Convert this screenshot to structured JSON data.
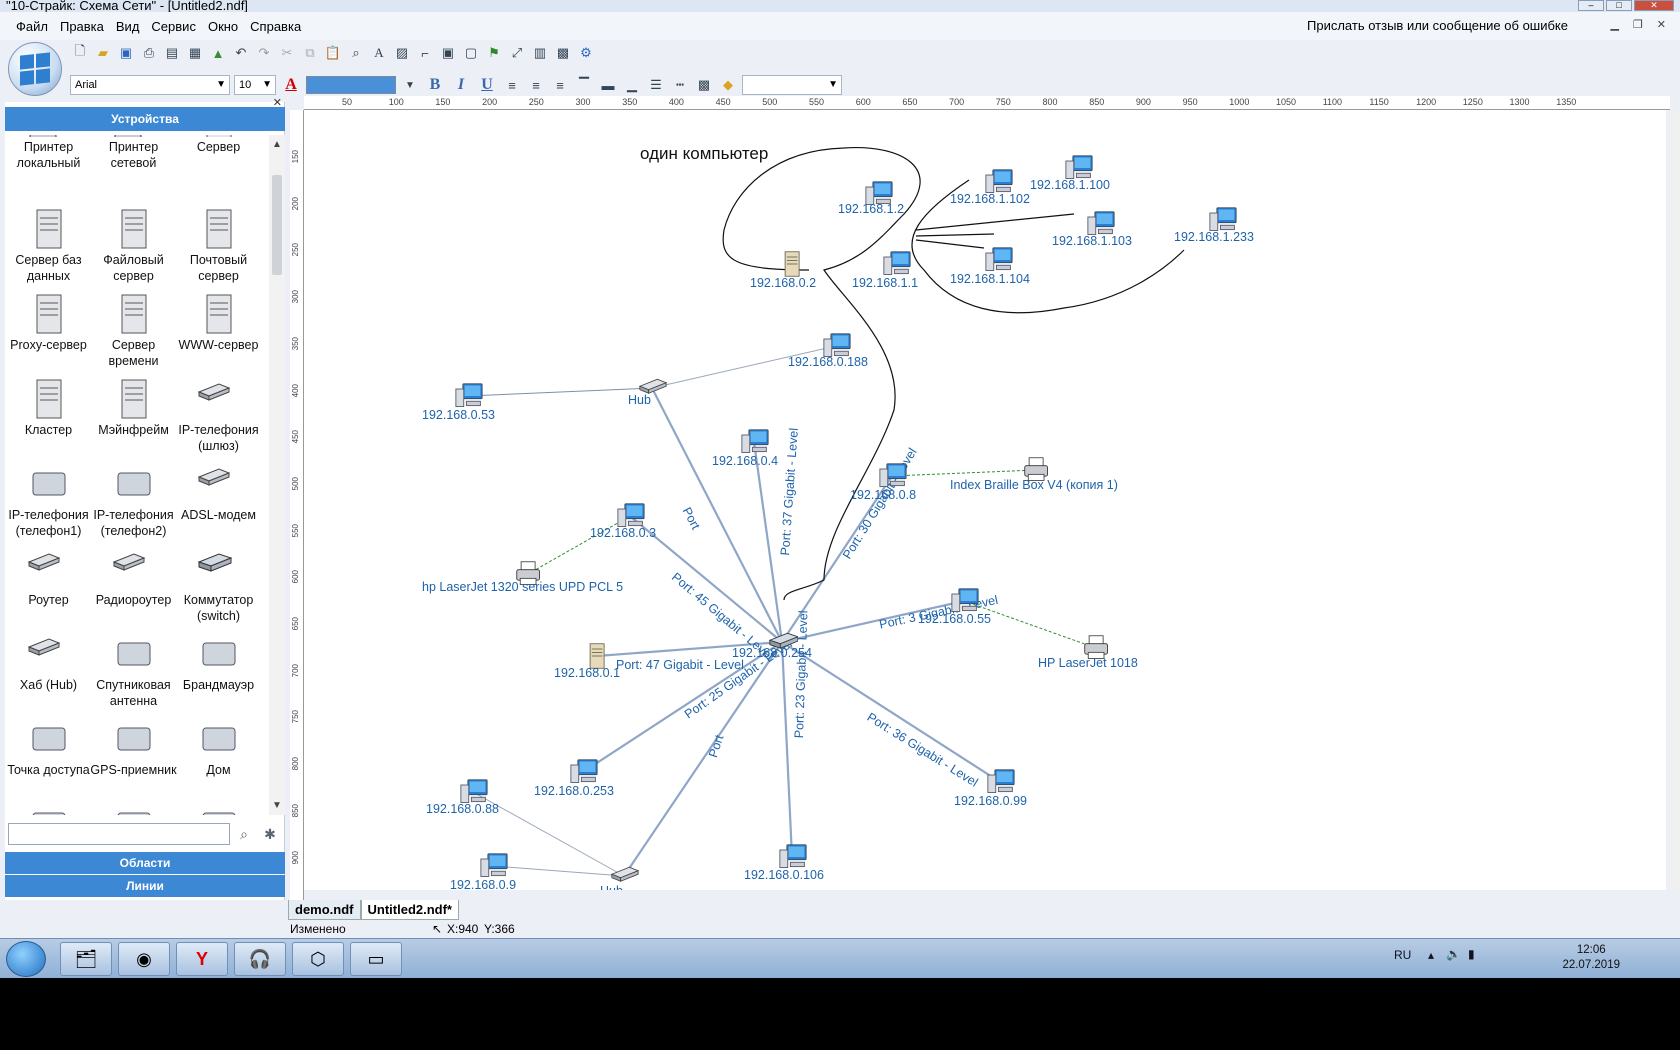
{
  "window": {
    "title": "\"10-Страйк: Схема Сети\" - [Untitled2.ndf]"
  },
  "menu": [
    "Файл",
    "Правка",
    "Вид",
    "Сервис",
    "Окно",
    "Справка"
  ],
  "feedback": "Прислать отзыв или сообщение об ошибке",
  "format": {
    "font": "Arial",
    "size": "10"
  },
  "panel": {
    "header": "Устройства",
    "devices": [
      "Принтер локальный",
      "Принтер сетевой",
      "Сервер",
      "Сервер баз данных",
      "Файловый сервер",
      "Почтовый сервер",
      "Proxy-сервер",
      "Сервер времени",
      "WWW-сервер",
      "Кластер",
      "Мэйнфрейм",
      "IP-телефония (шлюз)",
      "IP-телефония (телефон1)",
      "IP-телефония (телефон2)",
      "ADSL-модем",
      "Роутер",
      "Радиороутер",
      "Коммутатор (switch)",
      "Хаб (Hub)",
      "Спутниковая антенна",
      "Брандмауэр",
      "Точка доступа",
      "GPS-приемник",
      "Дом",
      "",
      "",
      ""
    ],
    "sections": [
      "Области",
      "Линии"
    ]
  },
  "ruler": {
    "h": [
      "50",
      "100",
      "150",
      "200",
      "250",
      "300",
      "350",
      "400",
      "450",
      "500",
      "550",
      "600",
      "650",
      "700",
      "750",
      "800",
      "850",
      "900",
      "950",
      "1000",
      "1050",
      "1100",
      "1150",
      "1200",
      "1250",
      "1300",
      "1350"
    ],
    "v": [
      "150",
      "200",
      "250",
      "300",
      "350",
      "400",
      "450",
      "500",
      "550",
      "600",
      "650",
      "700",
      "750",
      "800",
      "850",
      "900"
    ]
  },
  "diagram": {
    "note": "один компьютер",
    "nodes": [
      {
        "id": "pc1",
        "label": "192.168.1.2",
        "icon": "computer-icon"
      },
      {
        "id": "pc2",
        "label": "192.168.1.102",
        "icon": "computer-icon"
      },
      {
        "id": "pc3",
        "label": "192.168.1.100",
        "icon": "computer-icon"
      },
      {
        "id": "pc4",
        "label": "192.168.1.103",
        "icon": "computer-icon"
      },
      {
        "id": "pc5",
        "label": "192.168.1.233",
        "icon": "computer-icon"
      },
      {
        "id": "srv1",
        "label": "192.168.0.2",
        "icon": "server-icon"
      },
      {
        "id": "pc6",
        "label": "192.168.1.1",
        "icon": "computer-icon"
      },
      {
        "id": "pc7",
        "label": "192.168.1.104",
        "icon": "computer-icon"
      },
      {
        "id": "pc8",
        "label": "192.168.0.188",
        "icon": "computer-icon"
      },
      {
        "id": "pc9",
        "label": "192.168.0.53",
        "icon": "computer-icon"
      },
      {
        "id": "hub1",
        "label": "Hub",
        "icon": "hub-icon"
      },
      {
        "id": "pc10",
        "label": "192.168.0.4",
        "icon": "computer-icon"
      },
      {
        "id": "pc11",
        "label": "192.168.0.8",
        "icon": "computer-icon"
      },
      {
        "id": "prn1",
        "label": "Index Braille Box V4 (копия 1)",
        "icon": "printer-icon"
      },
      {
        "id": "pc12",
        "label": "192.168.0.3",
        "icon": "computer-icon"
      },
      {
        "id": "prn2",
        "label": "hp LaserJet 1320 series UPD PCL 5",
        "icon": "printer-icon"
      },
      {
        "id": "pc13",
        "label": "192.168.0.55",
        "icon": "computer-icon"
      },
      {
        "id": "prn3",
        "label": "HP LaserJet 1018",
        "icon": "printer-icon"
      },
      {
        "id": "sw",
        "label": "192.168.0.254",
        "icon": "switch-icon"
      },
      {
        "id": "srv2",
        "label": "192.168.0.1",
        "icon": "server-icon"
      },
      {
        "id": "pc14",
        "label": "192.168.0.88",
        "icon": "computer-icon"
      },
      {
        "id": "pc15",
        "label": "192.168.0.253",
        "icon": "computer-icon"
      },
      {
        "id": "pc16",
        "label": "192.168.0.99",
        "icon": "computer-icon"
      },
      {
        "id": "pc17",
        "label": "192.168.0.9",
        "icon": "computer-icon"
      },
      {
        "id": "hub2",
        "label": "Hub",
        "icon": "hub-icon"
      },
      {
        "id": "pc18",
        "label": "192.168.0.106",
        "icon": "computer-icon"
      }
    ],
    "links": [
      {
        "label": "Port"
      },
      {
        "label": "Port: 37 Gigabit - Level"
      },
      {
        "label": "Port: 30 Gigabit - Level"
      },
      {
        "label": "Port: 45 Gigabit - Level"
      },
      {
        "label": "Port: 3 Gigabit - Level"
      },
      {
        "label": "Port: 47 Gigabit - Level"
      },
      {
        "label": "Port: 25 Gigabit - Level"
      },
      {
        "label": "Port"
      },
      {
        "label": "Port: 23 Gigabit - Level"
      },
      {
        "label": "Port: 36 Gigabit - Level"
      }
    ]
  },
  "tabs": [
    "demo.ndf",
    "Untitled2.ndf*"
  ],
  "status": {
    "state": "Изменено",
    "x": "X:940",
    "y": "Y:366"
  },
  "taskbar": {
    "lang": "RU",
    "time": "12:06",
    "date": "22.07.2019"
  },
  "colors": {
    "accent": "#3d88d4",
    "link": "#8ea6c8",
    "label": "#1e63aa"
  }
}
